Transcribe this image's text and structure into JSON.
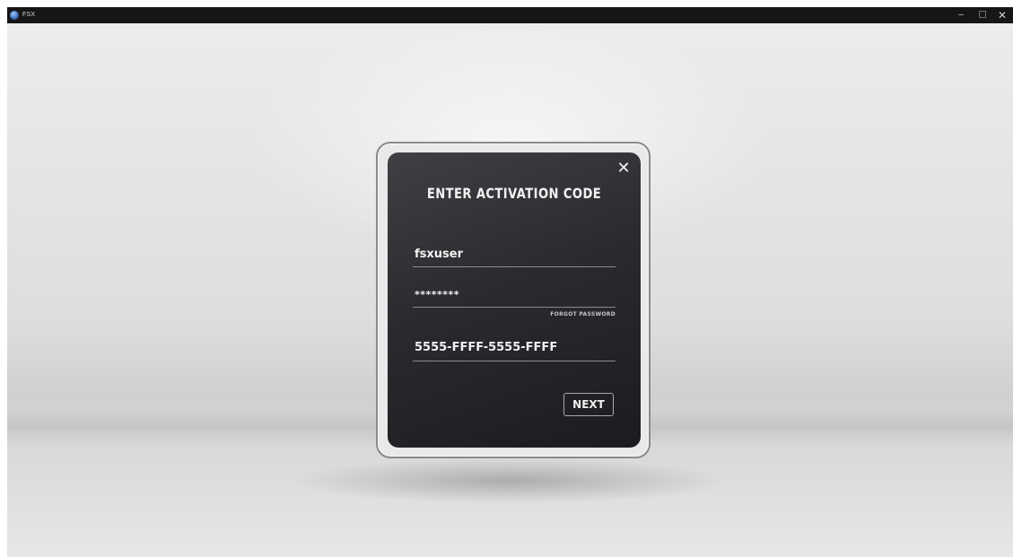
{
  "window": {
    "app_title": "FSX",
    "minimize_glyph": "–",
    "close_glyph": "✕",
    "icons": [
      "fsx-app-icon",
      "minimize-icon",
      "maximize-icon",
      "close-icon"
    ]
  },
  "dialog": {
    "title": "ENTER ACTIVATION CODE",
    "close_glyph": "✕",
    "username_value": "fsxuser",
    "password_value": "********",
    "forgot_password_label": "FORGOT PASSWORD",
    "activation_code_value": "5555-FFFF-5555-FFFF",
    "next_label": "NEXT"
  },
  "colors": {
    "panel": "#2b2b2f",
    "titlebar": "#161616",
    "text": "#f2f2f2"
  }
}
